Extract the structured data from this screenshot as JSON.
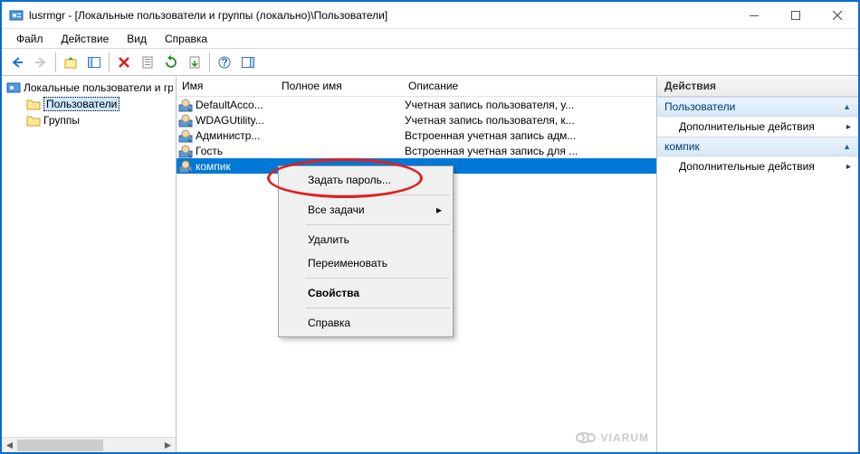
{
  "window": {
    "title": "lusrmgr - [Локальные пользователи и группы (локально)\\Пользователи]"
  },
  "menubar": {
    "items": [
      "Файл",
      "Действие",
      "Вид",
      "Справка"
    ]
  },
  "tree": {
    "root": "Локальные пользователи и гру",
    "children": [
      {
        "label": "Пользователи",
        "selected": true
      },
      {
        "label": "Группы",
        "selected": false
      }
    ]
  },
  "list": {
    "columns": {
      "name": "Имя",
      "full": "Полное имя",
      "desc": "Описание"
    },
    "col_widths": {
      "name": 110,
      "full": 140,
      "desc": 260
    },
    "rows": [
      {
        "name": "DefaultAcco...",
        "full": "",
        "desc": "Учетная запись пользователя, у...",
        "selected": false
      },
      {
        "name": "WDAGUtility...",
        "full": "",
        "desc": "Учетная запись пользователя, к...",
        "selected": false
      },
      {
        "name": "Администр...",
        "full": "",
        "desc": "Встроенная учетная запись адм...",
        "selected": false
      },
      {
        "name": "Гость",
        "full": "",
        "desc": "Встроенная учетная запись для ...",
        "selected": false
      },
      {
        "name": "компик",
        "full": "",
        "desc": "",
        "selected": true
      }
    ]
  },
  "context_menu": {
    "items": [
      {
        "label": "Задать пароль...",
        "type": "item"
      },
      {
        "type": "sep"
      },
      {
        "label": "Все задачи",
        "type": "item",
        "submenu": true
      },
      {
        "type": "sep"
      },
      {
        "label": "Удалить",
        "type": "item"
      },
      {
        "label": "Переименовать",
        "type": "item"
      },
      {
        "type": "sep"
      },
      {
        "label": "Свойства",
        "type": "item",
        "bold": true
      },
      {
        "type": "sep"
      },
      {
        "label": "Справка",
        "type": "item"
      }
    ]
  },
  "actions": {
    "header": "Действия",
    "groups": [
      {
        "title": "Пользователи",
        "items": [
          "Дополнительные действия"
        ]
      },
      {
        "title": "компик",
        "items": [
          "Дополнительные действия"
        ]
      }
    ]
  },
  "watermark": "VIARUM"
}
